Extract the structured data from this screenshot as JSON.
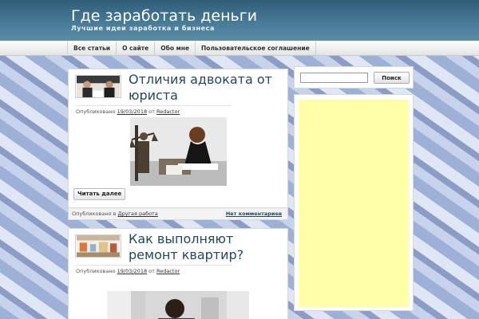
{
  "site": {
    "title": "Где заработать деньги",
    "description": "Лучшие идеи заработка и бизнеса"
  },
  "nav": {
    "items": [
      "Все статьи",
      "О сайте",
      "Обо мне",
      "Пользовательское соглашение"
    ]
  },
  "posts": [
    {
      "title": "Отличия адвоката от юриста",
      "meta_prefix": "Опубликовано",
      "date": "19/03/2018",
      "meta_by": "от",
      "author": "Redactor",
      "read_more": "Читать далее",
      "footer_prefix": "Опубликовано в",
      "category": "Другая работа",
      "comments": "Нет комментариев"
    },
    {
      "title": "Как выполняют ремонт квартир?",
      "meta_prefix": "Опубликовано",
      "date": "19/03/2018",
      "meta_by": "от",
      "author": "Redactor"
    }
  ],
  "sidebar": {
    "search_value": "",
    "search_button": "Поиск",
    "ad_color": "#ffffa8"
  }
}
